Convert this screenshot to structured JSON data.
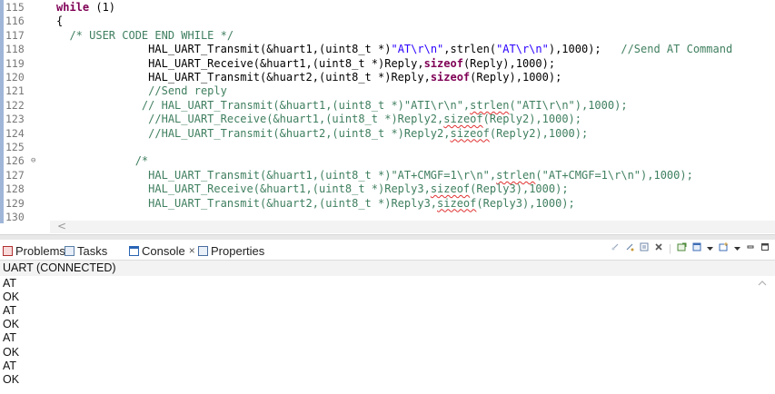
{
  "editor": {
    "lines": [
      {
        "num": "115",
        "fold": "",
        "segs": [
          {
            "t": "kw",
            "v": "while"
          },
          {
            "t": "plain",
            "v": " (1)"
          }
        ]
      },
      {
        "num": "116",
        "fold": "",
        "segs": [
          {
            "t": "plain",
            "v": "{"
          }
        ]
      },
      {
        "num": "117",
        "fold": "",
        "segs": [
          {
            "t": "cm",
            "v": "  /* USER CODE END WHILE */"
          }
        ]
      },
      {
        "num": "118",
        "fold": "",
        "segs": [
          {
            "t": "plain",
            "v": "              HAL_UART_Transmit(&huart1,(uint8_t *)"
          },
          {
            "t": "str",
            "v": "\"AT\\r\\n\""
          },
          {
            "t": "plain",
            "v": ",strlen("
          },
          {
            "t": "str",
            "v": "\"AT\\r\\n\""
          },
          {
            "t": "plain",
            "v": "),1000);   "
          },
          {
            "t": "cm",
            "v": "//Send AT Command"
          }
        ]
      },
      {
        "num": "119",
        "fold": "",
        "segs": [
          {
            "t": "plain",
            "v": "              HAL_UART_Receive(&huart1,(uint8_t *)Reply,"
          },
          {
            "t": "kw",
            "v": "sizeof"
          },
          {
            "t": "plain",
            "v": "(Reply),1000);"
          }
        ]
      },
      {
        "num": "120",
        "fold": "",
        "segs": [
          {
            "t": "plain",
            "v": "              HAL_UART_Transmit(&huart2,(uint8_t *)Reply,"
          },
          {
            "t": "kw",
            "v": "sizeof"
          },
          {
            "t": "plain",
            "v": "(Reply),1000);"
          }
        ]
      },
      {
        "num": "121",
        "fold": "",
        "segs": [
          {
            "t": "cm",
            "v": "              //Send reply"
          }
        ]
      },
      {
        "num": "122",
        "fold": "",
        "segs": [
          {
            "t": "cm",
            "v": "             // HAL_UART_Transmit(&huart1,(uint8_t *)\"ATI\\r\\n\","
          },
          {
            "t": "cmsq",
            "v": "strlen"
          },
          {
            "t": "cm",
            "v": "(\"ATI\\r\\n\"),1000);"
          }
        ]
      },
      {
        "num": "123",
        "fold": "",
        "segs": [
          {
            "t": "cm",
            "v": "              //HAL_UART_Receive(&huart1,(uint8_t *)Reply2,"
          },
          {
            "t": "cmsq",
            "v": "sizeof"
          },
          {
            "t": "cm",
            "v": "(Reply2),1000);"
          }
        ]
      },
      {
        "num": "124",
        "fold": "",
        "segs": [
          {
            "t": "cm",
            "v": "              //HAL_UART_Transmit(&huart2,(uint8_t *)Reply2,"
          },
          {
            "t": "cmsq",
            "v": "sizeof"
          },
          {
            "t": "cm",
            "v": "(Reply2),1000);"
          }
        ]
      },
      {
        "num": "125",
        "fold": "",
        "segs": []
      },
      {
        "num": "126",
        "fold": "⊖",
        "segs": [
          {
            "t": "cm",
            "v": "            /*"
          }
        ]
      },
      {
        "num": "127",
        "fold": "",
        "segs": [
          {
            "t": "cm",
            "v": "              HAL_UART_Transmit(&huart1,(uint8_t *)\"AT+CMGF=1\\r\\n\","
          },
          {
            "t": "cmsq",
            "v": "strlen"
          },
          {
            "t": "cm",
            "v": "(\"AT+CMGF=1\\r\\n\"),1000);"
          }
        ]
      },
      {
        "num": "128",
        "fold": "",
        "segs": [
          {
            "t": "cm",
            "v": "              HAL_UART_Receive(&huart1,(uint8_t *)Reply3,"
          },
          {
            "t": "cmsq",
            "v": "sizeof"
          },
          {
            "t": "cm",
            "v": "(Reply3),1000);"
          }
        ]
      },
      {
        "num": "129",
        "fold": "",
        "segs": [
          {
            "t": "cm",
            "v": "              HAL_UART_Transmit(&huart2,(uint8_t *)Reply3,"
          },
          {
            "t": "cmsq",
            "v": "sizeof"
          },
          {
            "t": "cm",
            "v": "(Reply3),1000);"
          }
        ]
      },
      {
        "num": "130",
        "fold": "",
        "segs": []
      }
    ],
    "scroll_left_glyph": "<"
  },
  "views": {
    "tabs": [
      {
        "label": "Problems",
        "icon": "problems-icon",
        "active": false
      },
      {
        "label": "Tasks",
        "icon": "tasks-icon",
        "active": false
      },
      {
        "label": "Console",
        "icon": "console-icon",
        "active": true,
        "close": "×"
      },
      {
        "label": "Properties",
        "icon": "properties-icon",
        "active": false
      }
    ],
    "toolbar_icons": [
      "clear-console-icon",
      "scroll-lock-icon",
      "word-wrap-icon",
      "remove-launch-icon",
      "pin-console-icon",
      "display-console-icon",
      "open-console-icon",
      "minimize-icon",
      "maximize-icon"
    ]
  },
  "console": {
    "title": "UART (CONNECTED)",
    "lines": [
      "AT",
      "OK",
      "AT",
      "OK",
      "AT",
      "OK",
      "AT",
      "OK"
    ]
  },
  "colors": {
    "keyword": "#7f0055",
    "comment": "#3f7f5f",
    "string": "#2a00ff"
  }
}
